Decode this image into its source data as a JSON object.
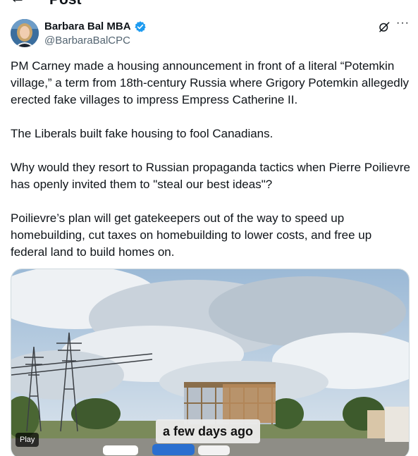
{
  "nav": {
    "back_icon": "arrow-left-icon",
    "title": "Post"
  },
  "author": {
    "display_name": "Barbara Bal MBA",
    "handle": "@BarbaraBalCPC",
    "verified_icon": "verified-badge-icon",
    "verified_color": "#1d9bf0"
  },
  "actions": {
    "grok_icon": "grok-icon",
    "more_icon": "more-icon",
    "more_label": "···"
  },
  "post": {
    "paragraphs": [
      "PM Carney made a housing announcement in front of a literal “Potemkin village,” a term from 18th-century Russia where Grigory Potemkin allegedly erected fake villages to impress Empress Catherine II.",
      "The Liberals built fake housing to fool Canadians.",
      "Why would they resort to Russian propaganda tactics when Pierre Poilievre has openly invited them to \"steal our best ideas\"?",
      "Poilievre’s plan will get gatekeepers out of the way to speed up homebuilding, cut taxes on homebuilding to lower costs, and free up federal land to build homes on."
    ]
  },
  "media": {
    "caption": "a few days ago",
    "play_label": "Play"
  },
  "colors": {
    "text": "#0f1419",
    "secondary": "#536471",
    "accent": "#1d9bf0"
  }
}
